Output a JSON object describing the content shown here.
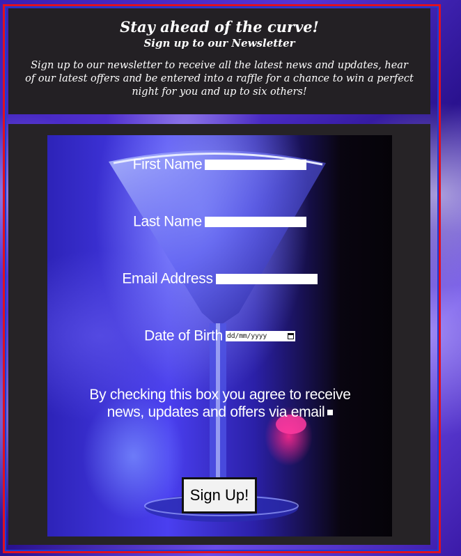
{
  "header": {
    "title": "Stay ahead of the curve!",
    "subtitle": "Sign up to our Newsletter",
    "description": "Sign up to our newsletter to receive all the latest news and updates, hear of our latest offers and be entered into a raffle for a chance to win a perfect night for you and up to six others!"
  },
  "form": {
    "first_name_label": "First Name",
    "first_name_value": "",
    "last_name_label": "Last Name",
    "last_name_value": "",
    "email_label": "Email Address",
    "email_value": "",
    "dob_label": "Date of Birth",
    "dob_placeholder": "dd/mm/yyyy",
    "consent_label": "By checking this box you agree to receive news, updates and offers via email",
    "consent_checked": false,
    "submit_label": "Sign Up!"
  },
  "icons": {
    "calendar": "calendar-icon"
  },
  "colors": {
    "frame_border": "#e01020",
    "band_background": "#232024",
    "background_accent": "#5634d6"
  }
}
